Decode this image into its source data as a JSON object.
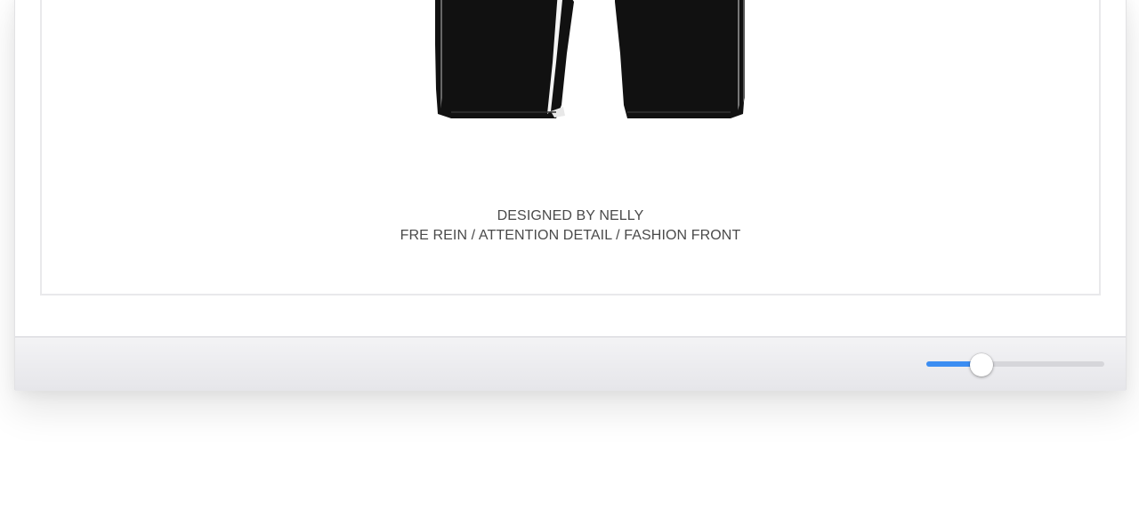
{
  "product": {
    "image_icon": "shorts-garment-image",
    "caption_line1": "DESIGNED BY NELLY",
    "caption_line2": "FRE REIN / ATTENTION DETAIL / FASHION FRONT"
  },
  "footer": {
    "zoom_slider": {
      "value_fraction": 0.31,
      "accent_color": "#3b8df2",
      "track_color": "#d6d6da"
    }
  }
}
